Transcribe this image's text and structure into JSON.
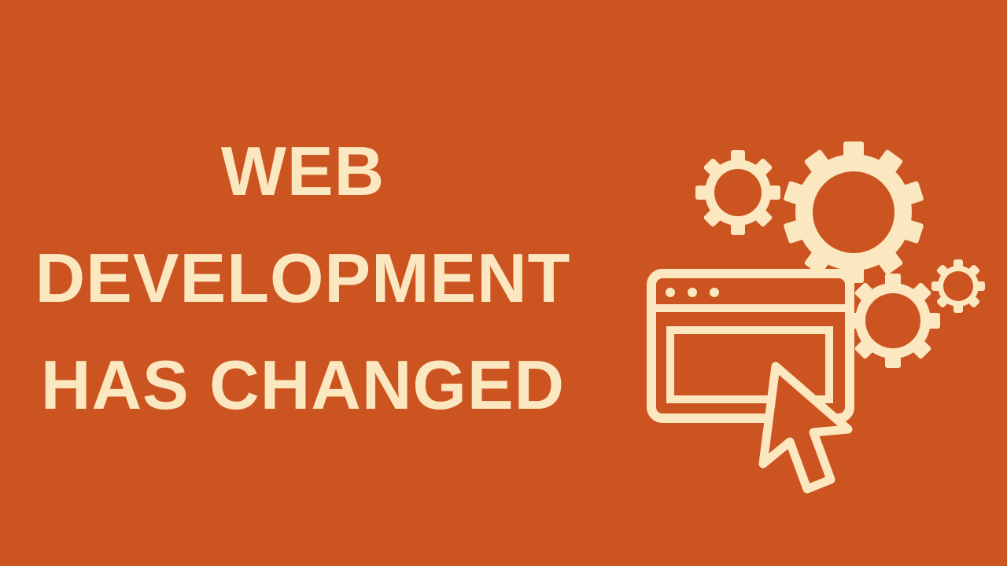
{
  "headline": {
    "lines": [
      "WEB",
      "DEVELOPMENT",
      "HAS CHANGED"
    ]
  },
  "illustration": {
    "icons": [
      "gear-icon",
      "browser-window-icon",
      "cursor-icon"
    ]
  },
  "colors": {
    "background": "#cc5421",
    "foreground": "#fbe7c0"
  }
}
